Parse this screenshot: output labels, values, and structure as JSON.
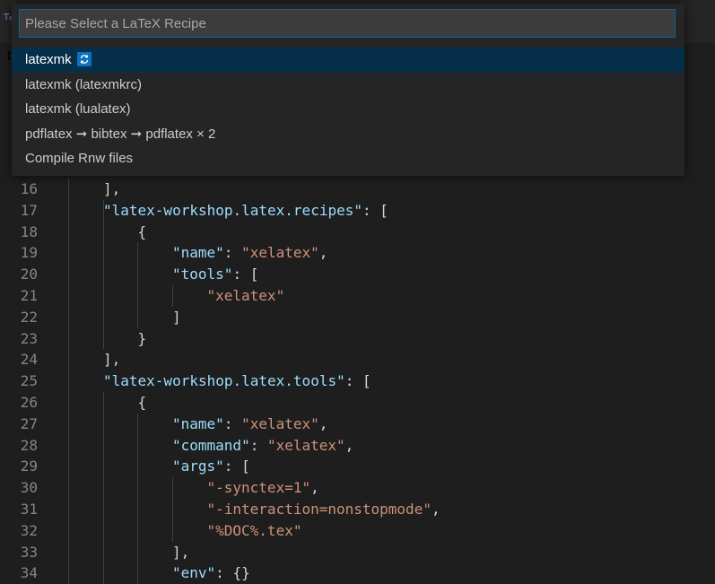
{
  "tabstrip": {
    "icon_glyph": "Tᵦ",
    "tab_letter": "t"
  },
  "quickpick": {
    "placeholder": "Please Select a LaTeX Recipe",
    "items": [
      {
        "label": "latexmk",
        "badge_icon": "sync-icon"
      },
      {
        "label": "latexmk (latexmkrc)"
      },
      {
        "label": "latexmk (lualatex)"
      },
      {
        "label": "pdflatex ➞ bibtex ➞ pdflatex × 2"
      },
      {
        "label": "Compile Rnw files"
      }
    ]
  },
  "editor": {
    "lines": [
      {
        "n": "16",
        "indent": 2,
        "parts": [
          [
            "pun",
            "],"
          ]
        ]
      },
      {
        "n": "17",
        "indent": 2,
        "parts": [
          [
            "key",
            "\"latex-workshop.latex.recipes\""
          ],
          [
            "pun",
            ": ["
          ]
        ]
      },
      {
        "n": "18",
        "indent": 3,
        "parts": [
          [
            "pun",
            "{"
          ]
        ]
      },
      {
        "n": "19",
        "indent": 4,
        "parts": [
          [
            "key",
            "\"name\""
          ],
          [
            "pun",
            ": "
          ],
          [
            "str",
            "\"xelatex\""
          ],
          [
            "pun",
            ","
          ]
        ]
      },
      {
        "n": "20",
        "indent": 4,
        "parts": [
          [
            "key",
            "\"tools\""
          ],
          [
            "pun",
            ": ["
          ]
        ]
      },
      {
        "n": "21",
        "indent": 5,
        "parts": [
          [
            "str",
            "\"xelatex\""
          ]
        ]
      },
      {
        "n": "22",
        "indent": 4,
        "parts": [
          [
            "pun",
            "]"
          ]
        ]
      },
      {
        "n": "23",
        "indent": 3,
        "parts": [
          [
            "pun",
            "}"
          ]
        ]
      },
      {
        "n": "24",
        "indent": 2,
        "parts": [
          [
            "pun",
            "],"
          ]
        ]
      },
      {
        "n": "25",
        "indent": 2,
        "parts": [
          [
            "key",
            "\"latex-workshop.latex.tools\""
          ],
          [
            "pun",
            ": ["
          ]
        ]
      },
      {
        "n": "26",
        "indent": 3,
        "parts": [
          [
            "pun",
            "{"
          ]
        ]
      },
      {
        "n": "27",
        "indent": 4,
        "parts": [
          [
            "key",
            "\"name\""
          ],
          [
            "pun",
            ": "
          ],
          [
            "str",
            "\"xelatex\""
          ],
          [
            "pun",
            ","
          ]
        ]
      },
      {
        "n": "28",
        "indent": 4,
        "parts": [
          [
            "key",
            "\"command\""
          ],
          [
            "pun",
            ": "
          ],
          [
            "str",
            "\"xelatex\""
          ],
          [
            "pun",
            ","
          ]
        ]
      },
      {
        "n": "29",
        "indent": 4,
        "parts": [
          [
            "key",
            "\"args\""
          ],
          [
            "pun",
            ": ["
          ]
        ]
      },
      {
        "n": "30",
        "indent": 5,
        "parts": [
          [
            "str",
            "\"-synctex=1\""
          ],
          [
            "pun",
            ","
          ]
        ]
      },
      {
        "n": "31",
        "indent": 5,
        "parts": [
          [
            "str",
            "\"-interaction=nonstopmode\""
          ],
          [
            "pun",
            ","
          ]
        ]
      },
      {
        "n": "32",
        "indent": 5,
        "parts": [
          [
            "str",
            "\"%DOC%.tex\""
          ]
        ]
      },
      {
        "n": "33",
        "indent": 4,
        "parts": [
          [
            "pun",
            "],"
          ]
        ]
      },
      {
        "n": "34",
        "indent": 4,
        "parts": [
          [
            "key",
            "\"env\""
          ],
          [
            "pun",
            ": {}"
          ]
        ]
      }
    ]
  },
  "colors": {
    "editor_bg": "#1e1e1e",
    "key": "#9cdcfe",
    "string": "#ce9178",
    "line_number": "#858585",
    "selected_item_bg": "#062f4a",
    "input_border": "#0e639c"
  }
}
